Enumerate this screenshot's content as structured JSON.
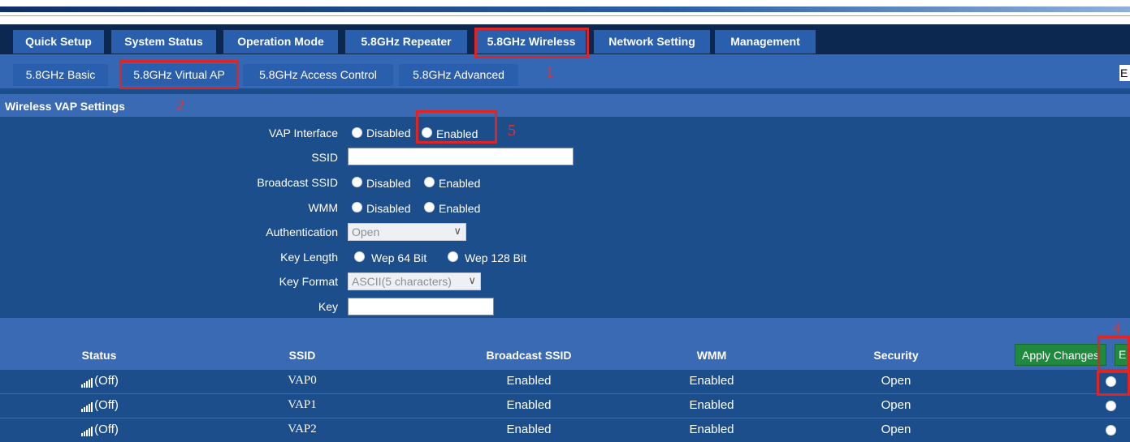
{
  "main_tabs": [
    {
      "label": "Quick Setup"
    },
    {
      "label": "System Status"
    },
    {
      "label": "Operation Mode"
    },
    {
      "label": "5.8GHz Repeater"
    },
    {
      "label": "5.8GHz Wireless"
    },
    {
      "label": "Network Setting"
    },
    {
      "label": "Management"
    }
  ],
  "sub_tabs": [
    {
      "label": "5.8GHz Basic"
    },
    {
      "label": "5.8GHz Virtual AP"
    },
    {
      "label": "5.8GHz Access Control"
    },
    {
      "label": "5.8GHz Advanced"
    }
  ],
  "language_box": "E",
  "section_title": "Wireless VAP Settings",
  "form": {
    "vap_interface": {
      "label": "VAP Interface",
      "opt1": "Disabled",
      "opt2": "Enabled"
    },
    "ssid": {
      "label": "SSID",
      "value": ""
    },
    "broadcast_ssid": {
      "label": "Broadcast SSID",
      "opt1": "Disabled",
      "opt2": "Enabled"
    },
    "wmm": {
      "label": "WMM",
      "opt1": "Disabled",
      "opt2": "Enabled"
    },
    "authentication": {
      "label": "Authentication",
      "value": "Open"
    },
    "key_length": {
      "label": "Key Length",
      "opt1": "Wep 64 Bit",
      "opt2": "Wep 128 Bit"
    },
    "key_format": {
      "label": "Key Format",
      "value": "ASCII(5 characters)"
    },
    "key": {
      "label": "Key",
      "value": ""
    }
  },
  "table": {
    "headers": [
      "Status",
      "SSID",
      "Broadcast SSID",
      "WMM",
      "Security"
    ],
    "apply_label": "Apply Changes",
    "second_button_label": "E",
    "rows": [
      {
        "status": "(Off)",
        "ssid": "VAP0",
        "broadcast": "Enabled",
        "wmm": "Enabled",
        "security": "Open"
      },
      {
        "status": "(Off)",
        "ssid": "VAP1",
        "broadcast": "Enabled",
        "wmm": "Enabled",
        "security": "Open"
      },
      {
        "status": "(Off)",
        "ssid": "VAP2",
        "broadcast": "Enabled",
        "wmm": "Enabled",
        "security": "Open"
      }
    ]
  },
  "annotations": {
    "n1": "1",
    "n2": "2",
    "n4": "4",
    "n5": "5"
  },
  "colors": {
    "nav_dark": "#0d2850",
    "tab_blue": "#2a5fae",
    "panel_blue": "#1d4e8c",
    "highlight_red": "#e02424",
    "apply_green": "#1f8a3d"
  }
}
